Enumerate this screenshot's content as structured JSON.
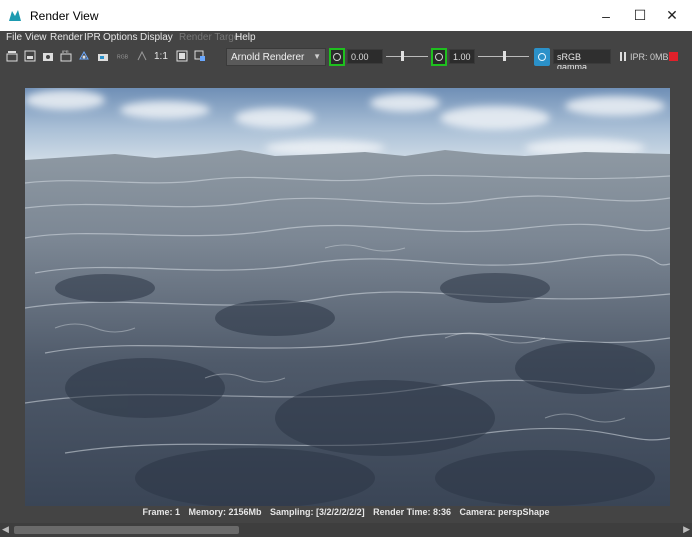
{
  "window": {
    "title": "Render View",
    "minimize_glyph": "–",
    "maximize_glyph": "☐",
    "close_glyph": "✕"
  },
  "menu": {
    "items": [
      {
        "label": "File",
        "enabled": true
      },
      {
        "label": "View",
        "enabled": true
      },
      {
        "label": "Render",
        "enabled": true
      },
      {
        "label": "IPR",
        "enabled": true
      },
      {
        "label": "Options",
        "enabled": true
      },
      {
        "label": "Display",
        "enabled": true
      },
      {
        "label": "Render Target",
        "enabled": false
      },
      {
        "label": "Help",
        "enabled": true
      }
    ]
  },
  "toolbar": {
    "size_label": "1:1",
    "renderer": "Arnold Renderer",
    "exposure_value": "0.00",
    "gamma_value": "1.00",
    "color_management": "sRGB gamma",
    "ipr_memory": "IPR: 0MB",
    "icons": [
      "render-frame-icon",
      "render-region-icon",
      "snapshot-icon",
      "ipr-render-icon",
      "refresh-icon",
      "keep-image-icon",
      "rgb-channels-icon",
      "alpha-icon",
      "display-size-icon",
      "frame-icon",
      "settings-icon"
    ]
  },
  "status": {
    "frame": "Frame: 1",
    "memory": "Memory: 2156Mb",
    "sampling": "Sampling: [3/2/2/2/2/2]",
    "render_time": "Render Time: 8:36",
    "camera": "Camera: perspShape"
  },
  "colors": {
    "app_bg": "#444444",
    "accent_green": "#1ec01e",
    "color_mgmt_blue": "#2b91c9",
    "stop_red": "#e0202a"
  }
}
